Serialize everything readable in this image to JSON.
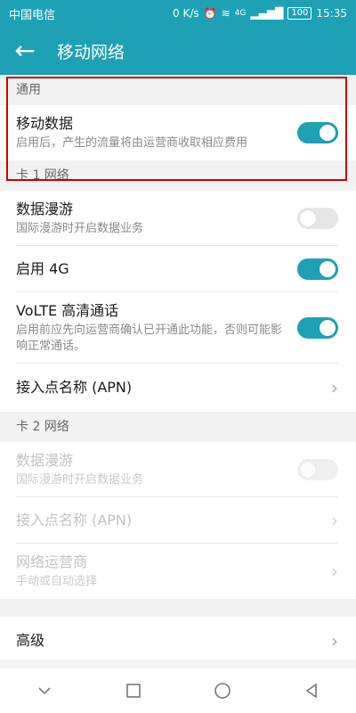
{
  "status": {
    "carrier": "中国电信",
    "speed": "0 K/s",
    "signal": "4G",
    "battery": "100",
    "time": "15:35"
  },
  "appbar": {
    "title": "移动网络"
  },
  "sections": {
    "general": {
      "header": "通用"
    },
    "sim1": {
      "header": "卡 1 网络"
    },
    "sim2": {
      "header": "卡 2 网络"
    }
  },
  "rows": {
    "mobile_data": {
      "title": "移动数据",
      "subtitle": "启用后，产生的流量将由运营商收取相应费用",
      "enabled": true
    },
    "sim1_roaming": {
      "title": "数据漫游",
      "subtitle": "国际漫游时开启数据业务",
      "enabled": false
    },
    "sim1_4g": {
      "title": "启用 4G",
      "enabled": true
    },
    "sim1_volte": {
      "title": "VoLTE 高清通话",
      "subtitle": "启用前应先向运营商确认已开通此功能，否则可能影响正常通话。",
      "enabled": true
    },
    "sim1_apn": {
      "title": "接入点名称 (APN)"
    },
    "sim2_roaming": {
      "title": "数据漫游",
      "subtitle": "国际漫游时开启数据业务",
      "enabled": false
    },
    "sim2_apn": {
      "title": "接入点名称 (APN)"
    },
    "sim2_operator": {
      "title": "网络运营商",
      "subtitle": "手动或自动选择"
    },
    "advanced": {
      "title": "高级"
    }
  },
  "colors": {
    "accent": "#1ea1b4",
    "highlight_box": "#cc0000"
  },
  "nav": {
    "back_icon": "chevron-down-icon",
    "home_icon": "circle-home-icon",
    "recent_icon": "square-recent-icon",
    "triangle_icon": "triangle-back-icon"
  }
}
